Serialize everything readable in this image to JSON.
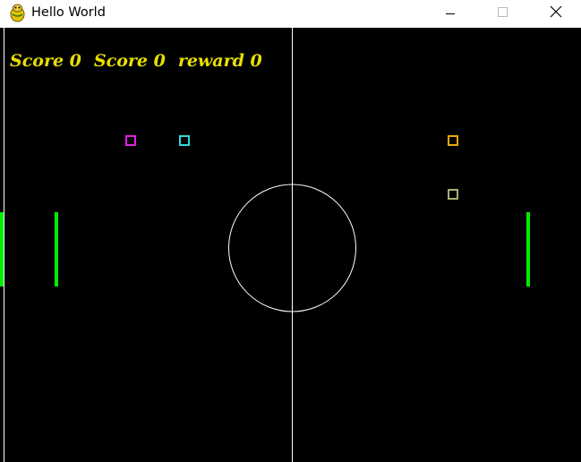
{
  "window": {
    "title": "Hello World",
    "icon": "pygame-snake-icon"
  },
  "hud": {
    "score_left": "Score 0",
    "score_right": "Score 0",
    "reward": "reward 0",
    "color": "#e8e000"
  },
  "game": {
    "background": "#000000",
    "line_color": "#ffffff",
    "paddle_color": "#00ee00",
    "markers": [
      {
        "name": "magenta-marker",
        "color": "#e020e0"
      },
      {
        "name": "cyan-marker",
        "color": "#30d8d8"
      },
      {
        "name": "orange-marker",
        "color": "#e8a800"
      },
      {
        "name": "olive-marker",
        "color": "#a8b070"
      }
    ]
  }
}
